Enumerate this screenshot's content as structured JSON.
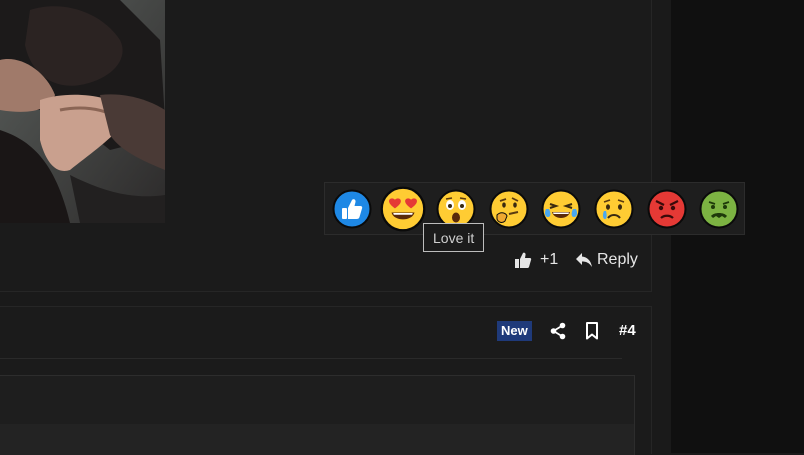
{
  "reactions": [
    {
      "name": "Like",
      "color": "#1e88e5"
    },
    {
      "name": "Love it",
      "color": "#ffcc33"
    },
    {
      "name": "Wow",
      "color": "#ffcc33"
    },
    {
      "name": "Hmm",
      "color": "#ffcc33"
    },
    {
      "name": "Haha",
      "color": "#ffcc33"
    },
    {
      "name": "Sad",
      "color": "#ffcc33"
    },
    {
      "name": "Angry",
      "color": "#e53935"
    },
    {
      "name": "Sick",
      "color": "#7cb342"
    }
  ],
  "tooltip": {
    "text": "Love it"
  },
  "post_actions": {
    "plus_one_label": "+1",
    "reply_label": "Reply"
  },
  "post_header": {
    "badge_label": "New",
    "post_number": "#4"
  },
  "colors": {
    "badge_bg": "#1f3a7a",
    "page_bg": "#1a1a1a"
  }
}
